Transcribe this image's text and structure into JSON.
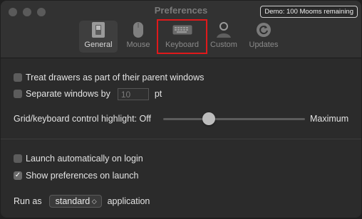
{
  "window": {
    "title": "Preferences",
    "demo_badge": "Demo: 100 Mooms remaining"
  },
  "tabs": [
    {
      "label": "General",
      "icon": "switch-icon",
      "selected": true
    },
    {
      "label": "Mouse",
      "icon": "mouse-icon",
      "selected": false
    },
    {
      "label": "Keyboard",
      "icon": "keyboard-icon",
      "selected": false,
      "highlighted": true
    },
    {
      "label": "Custom",
      "icon": "person-icon",
      "selected": false
    },
    {
      "label": "Updates",
      "icon": "refresh-icon",
      "selected": false
    }
  ],
  "options": {
    "treat_drawers": {
      "label": "Treat drawers as part of their parent windows",
      "checked": false
    },
    "separate_windows": {
      "label": "Separate windows by",
      "checked": false,
      "value": "10",
      "unit": "pt"
    },
    "highlight": {
      "label": "Grid/keyboard control highlight: Off",
      "max_label": "Maximum",
      "level": 0.32
    },
    "launch_login": {
      "label": "Launch automatically on login",
      "checked": false
    },
    "show_prefs": {
      "label": "Show preferences on launch",
      "checked": true
    },
    "run_as": {
      "prefix": "Run as",
      "value": "standard",
      "suffix": "application"
    }
  }
}
